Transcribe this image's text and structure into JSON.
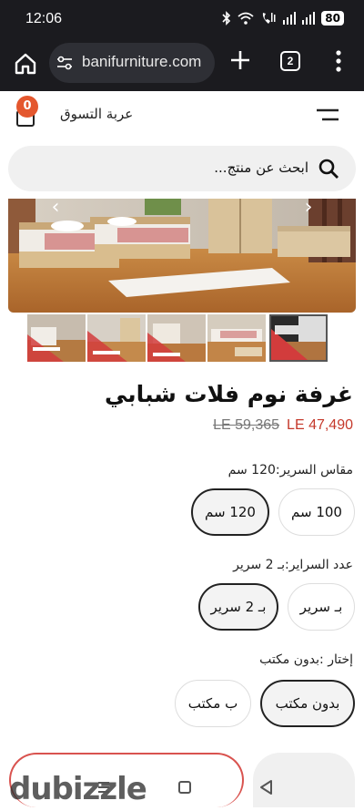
{
  "status_bar": {
    "time": "12:06",
    "battery": "80"
  },
  "browser": {
    "url": "banifurniture.com",
    "tab_count": "2"
  },
  "header": {
    "cart_label": "عربة التسوق",
    "cart_count": "0"
  },
  "search": {
    "placeholder": "ابحث عن منتج..."
  },
  "product": {
    "title": "غرفة نوم فلات شبابي",
    "price_current": "LE 47,490",
    "price_old": "LE 59,365",
    "thumbnail_count": 5,
    "active_thumbnail": 5
  },
  "options": {
    "bed_size": {
      "label": "مقاس السرير:120 سم",
      "values": [
        "100 سم",
        "120 سم"
      ],
      "selected": "120 سم"
    },
    "bed_count": {
      "label": "عدد السراير:بـ 2 سرير",
      "values": [
        "بـ سرير",
        "بـ 2 سرير"
      ],
      "selected": "بـ 2 سرير"
    },
    "desk": {
      "label": "إختار :بدون مكتب",
      "values": [
        "بدون مكتب",
        "ب مكتب"
      ],
      "selected": "بدون مكتب"
    }
  },
  "watermark": "dubizzle",
  "colors": {
    "accent": "#e4572e",
    "price": "#c5392b",
    "browser_bg": "#1b1b1f"
  }
}
